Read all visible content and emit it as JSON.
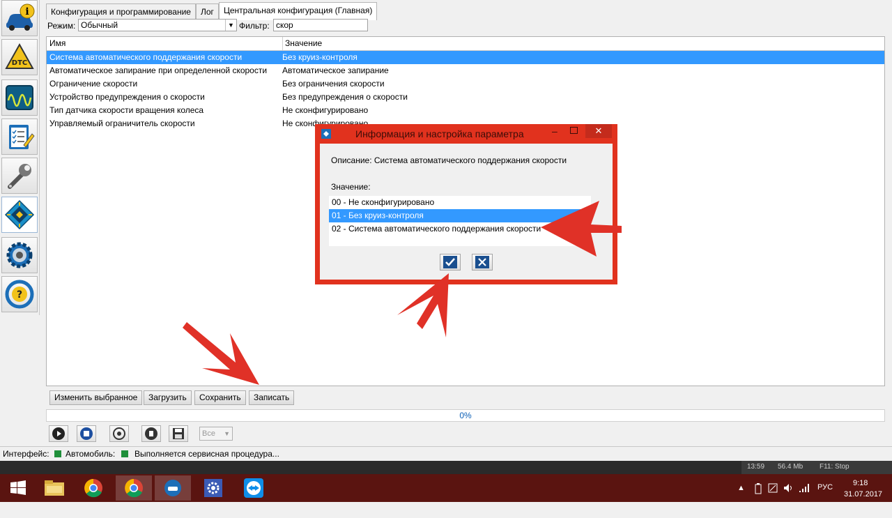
{
  "sidebar": {
    "items": [
      {
        "icon": "vehicle-info-icon"
      },
      {
        "icon": "dtc-icon",
        "label": "DTC"
      },
      {
        "icon": "oscilloscope-icon"
      },
      {
        "icon": "checklist-icon"
      },
      {
        "icon": "wrench-icon"
      },
      {
        "icon": "chip-icon",
        "active": true
      },
      {
        "icon": "gear-icon"
      },
      {
        "icon": "steering-help-icon",
        "label": "?"
      }
    ]
  },
  "tabs": [
    {
      "label": "Конфигурация и программирование",
      "selected": false
    },
    {
      "label": "Лог",
      "selected": false
    },
    {
      "label": "Центральная конфигурация (Главная)",
      "selected": true
    }
  ],
  "filter_bar": {
    "mode_label": "Режим:",
    "mode_value": "Обычный",
    "filter_label": "Фильтр:",
    "filter_value": "скор"
  },
  "table": {
    "headers": {
      "name": "Имя",
      "value": "Значение"
    },
    "rows": [
      {
        "name": "Система автоматического поддержания скорости",
        "value": "Без круиз-контроля",
        "selected": true
      },
      {
        "name": "Автоматическое запирание при определенной скорости",
        "value": "Автоматическое запирание"
      },
      {
        "name": "Ограничение скорости",
        "value": "Без ограничения скорости"
      },
      {
        "name": "Устройство предупреждения о скорости",
        "value": "Без предупреждения о скорости"
      },
      {
        "name": "Тип датчика скорости вращения колеса",
        "value": "Не сконфигурировано"
      },
      {
        "name": "Управляемый ограничитель скорости",
        "value": "Не сконфигурировано"
      }
    ]
  },
  "buttons": {
    "edit_selected": "Изменить выбранное",
    "load": "Загрузить",
    "save": "Сохранить",
    "write": "Записать"
  },
  "progress": {
    "text": "0%",
    "value": 0
  },
  "toolbar": {
    "icons": [
      "play-icon",
      "stop-icon",
      "radar-icon",
      "delete-icon",
      "floppy-icon"
    ],
    "scope_select": "Все"
  },
  "status": {
    "interface_label": "Интерфейс:",
    "vehicle_label": "Автомобиль:",
    "message": "Выполняется сервисная процедура...",
    "indicator_color": "#1f8f3a"
  },
  "recording_strip": {
    "time": "13:59",
    "size": "56.4 Mb",
    "hint": "F11: Stop"
  },
  "dialog": {
    "title": "Информация и настройка параметра",
    "description_label": "Описание: Система автоматического поддержания скорости",
    "value_label": "Значение:",
    "options": [
      {
        "text": "00 - Не сконфигурировано",
        "selected": false
      },
      {
        "text": "01 - Без круиз-контроля",
        "selected": true
      },
      {
        "text": "02 - Система автоматического поддержания скорости",
        "selected": false
      }
    ],
    "accent_color": "#e1321e"
  },
  "taskbar": {
    "apps": [
      "windows-start-icon",
      "file-explorer-icon",
      "chrome-icon",
      "chrome-icon",
      "diagnostic-app-icon",
      "settings-icon",
      "teamviewer-icon"
    ],
    "language": "РУС",
    "time": "9:18",
    "date": "31.07.2017"
  },
  "colors": {
    "selection": "#3399ff",
    "annotation_arrow": "#e03127",
    "taskbar": "#5a1410"
  }
}
